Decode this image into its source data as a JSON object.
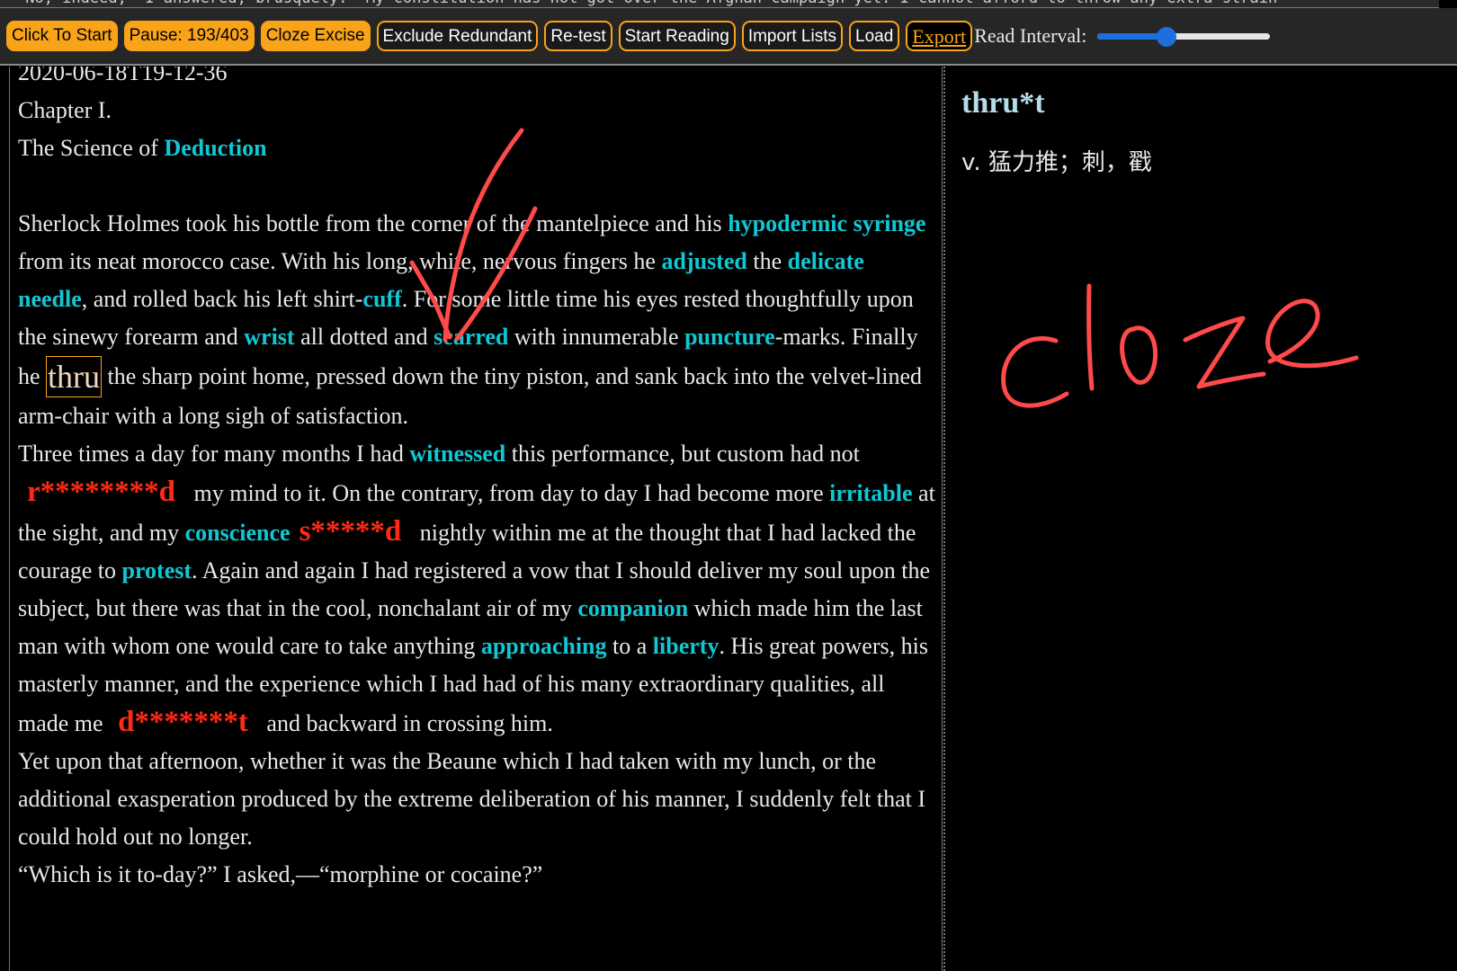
{
  "marquee": {
    "text": "“No, indeed,” I answered, brusquely. “My constitution has not got over the Afghan campaign yet. I cannot afford to throw any extra strain"
  },
  "toolbar": {
    "buttons": [
      {
        "label": "Click To Start"
      },
      {
        "label": "Pause: 193/403"
      },
      {
        "label": "Cloze Excise"
      },
      {
        "label": "Exclude Redundant"
      },
      {
        "label": "Re-test"
      },
      {
        "label": "Start Reading"
      },
      {
        "label": "Import Lists"
      },
      {
        "label": "Load"
      },
      {
        "label": "Export"
      }
    ],
    "interval_label": "Read Interval:",
    "interval_value": 0.4
  },
  "reader": {
    "timestamp": "2020-06-18T19-12-36",
    "chapter": "Chapter I.",
    "title_prefix": "The Science of ",
    "title_kw": "Deduction",
    "p1": [
      "Sherlock Holmes took his bottle from the corner of the mantelpiece and his ",
      "hypodermic syringe",
      " from its neat morocco case. With his long, white, nervous fingers he ",
      "adjusted",
      " the ",
      "delicate",
      " ",
      "needle",
      ", and rolled back his left shirt-",
      "cuff",
      ". For some little time his eyes rested thoughtfully upon the sinewy forearm and ",
      "wrist",
      " all dotted and ",
      "scarred",
      " with innumerable ",
      "puncture",
      "-marks. Finally he ",
      "thru",
      " the sharp point home, pressed down the tiny piston, and sank back into the velvet-lined arm-chair with a long sigh of satisfaction."
    ],
    "p2": [
      "Three times a day for many months I had ",
      "witnessed",
      " this performance, but custom had not ",
      "r********d",
      " my mind to it. On the contrary, from day to day I had become more ",
      "irritable",
      " at the sight, and my ",
      "conscience",
      "s*****d",
      " nightly within me at the thought that I had lacked the courage to ",
      "protest",
      ". Again and again I had registered a vow that I should deliver my soul upon the subject, but there was that in the cool, nonchalant air of my ",
      "companion",
      " which made him the last man with whom one would care to take anything ",
      "approaching",
      " to a ",
      "liberty",
      ". His great powers, his masterly manner, and the experience which I had had of his many extraordinary qualities, all made me ",
      "d*******t",
      " and backward in crossing him."
    ],
    "p3": "Yet upon that afternoon, whether it was the Beaune which I had taken with my lunch, or the additional exasperation produced by the extreme deliberation of his manner, I suddenly felt that I could hold out no longer.",
    "p4": "“Which is it to-day?” I asked,—“morphine or cocaine?”"
  },
  "definition": {
    "word": "thru*t",
    "meaning": "v. 猛力推；刺，戳"
  },
  "annotation": {
    "handwritten": "cloze"
  },
  "colors": {
    "accent": "#f9a318",
    "keyword": "#11c7d4",
    "cloze": "#ff2a16",
    "ink": "#ff4a4a",
    "slider": "#1d6fe0"
  }
}
